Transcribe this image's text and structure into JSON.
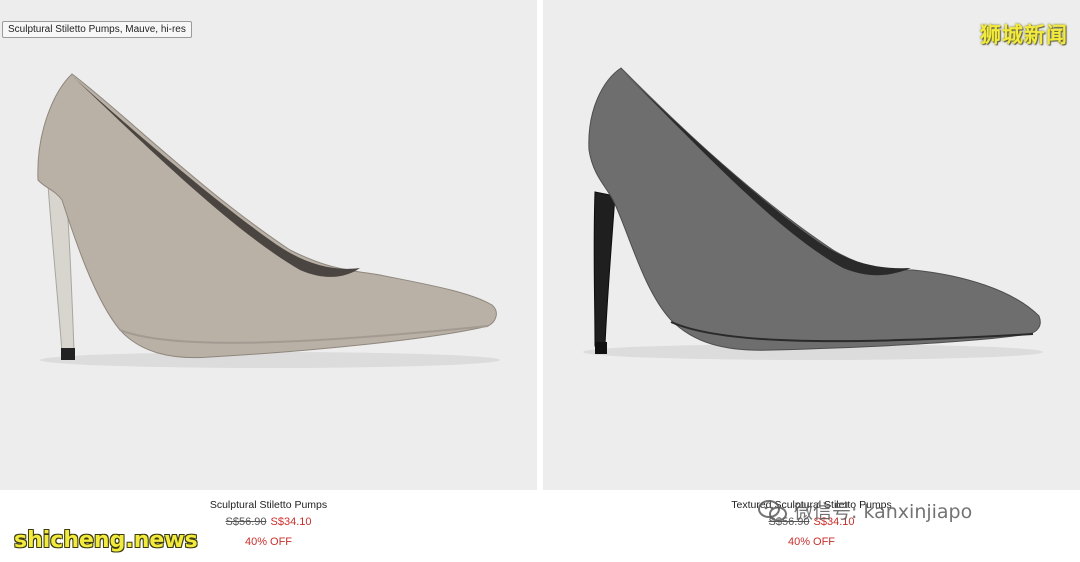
{
  "tooltip": "Sculptural Stiletto Pumps, Mauve, hi-res",
  "products": [
    {
      "name": "Sculptural Stiletto Pumps",
      "old_price": "S$56.90",
      "new_price": "S$34.10",
      "discount": "40% OFF",
      "shoe_color": "#b9b0a6",
      "heel_color": "#d6d4cf"
    },
    {
      "name": "Textured Sculptural Stiletto Pumps",
      "old_price": "S$56.90",
      "new_price": "S$34.10",
      "discount": "40% OFF",
      "shoe_color": "#6e6e6e",
      "heel_color": "#1f1f1f"
    }
  ],
  "watermarks": {
    "top_right": "狮城新闻",
    "bottom_left": "shicheng.news",
    "wechat": "微信号: kanxinjiapo"
  },
  "colors": {
    "background": "#ededed",
    "sale_red": "#c9302c",
    "watermark_yellow": "#f2ea3c"
  }
}
